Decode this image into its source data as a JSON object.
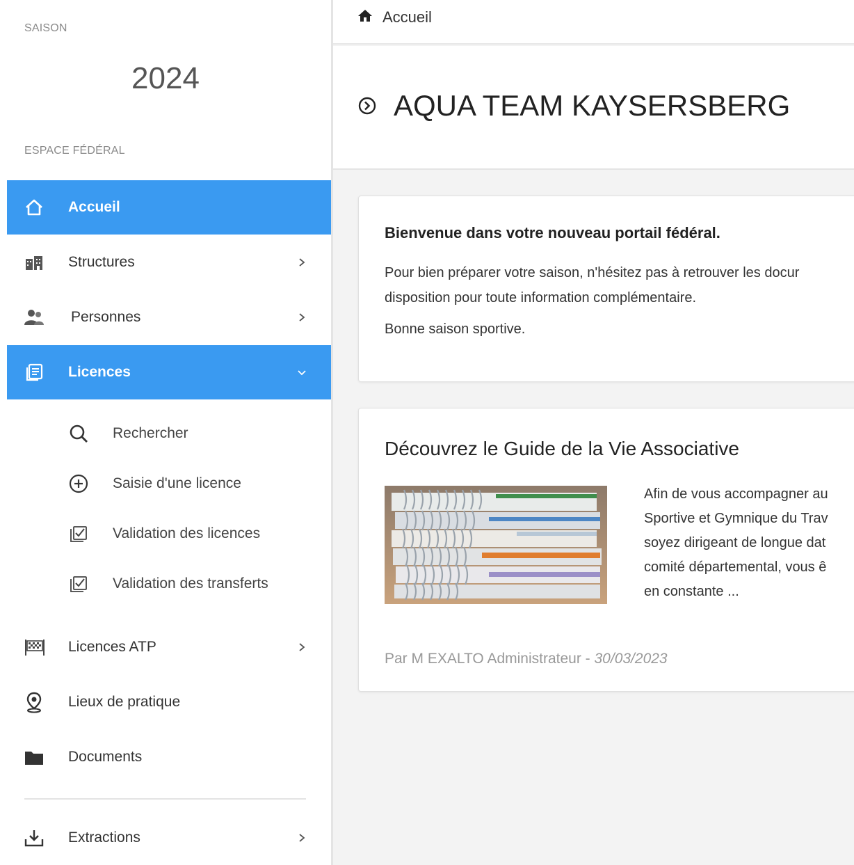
{
  "sidebar": {
    "season_label": "SAISON",
    "season_value": "2024",
    "section_label": "ESPACE FÉDÉRAL",
    "items": [
      {
        "label": "Accueil",
        "icon": "home-icon",
        "active": true
      },
      {
        "label": "Structures",
        "icon": "buildings-icon",
        "has_chevron": true
      },
      {
        "label": "Personnes",
        "icon": "people-icon",
        "has_chevron": true
      },
      {
        "label": "Licences",
        "icon": "cards-icon",
        "active": true,
        "expanded": true
      },
      {
        "label": "Licences ATP",
        "icon": "checkered-flag-icon",
        "has_chevron": true
      },
      {
        "label": "Lieux de pratique",
        "icon": "location-pin-icon"
      },
      {
        "label": "Documents",
        "icon": "folder-icon"
      },
      {
        "label": "Extractions",
        "icon": "download-tray-icon",
        "has_chevron": true
      }
    ],
    "licences_subitems": [
      {
        "label": "Rechercher",
        "icon": "search-icon"
      },
      {
        "label": "Saisie d'une licence",
        "icon": "plus-circle-icon"
      },
      {
        "label": "Validation des licences",
        "icon": "check-stack-icon"
      },
      {
        "label": "Validation des transferts",
        "icon": "check-stack-icon"
      }
    ]
  },
  "main": {
    "breadcrumb": {
      "label": "Accueil",
      "icon": "home-icon"
    },
    "page_title": "AQUA TEAM KAYSERSBERG",
    "welcome_card": {
      "title": "Bienvenue dans votre nouveau portail fédéral.",
      "line1": "Pour bien préparer votre saison, n'hésitez pas à retrouver les docur",
      "line2": "disposition pour toute information complémentaire.",
      "sign": "Bonne saison sportive."
    },
    "guide_card": {
      "title": "Découvrez le Guide de la Vie Associative",
      "text_lines": [
        "Afin de vous accompagner au",
        "Sportive et Gymnique du Trav",
        "soyez dirigeant de longue dat",
        "comité départemental, vous ê",
        "en constante ..."
      ],
      "author": "Par M EXALTO Administrateur - ",
      "date": "30/03/2023"
    }
  },
  "colors": {
    "accent": "#3a9af1",
    "sidebar_icon": "#444444",
    "meta_text": "#999999"
  }
}
